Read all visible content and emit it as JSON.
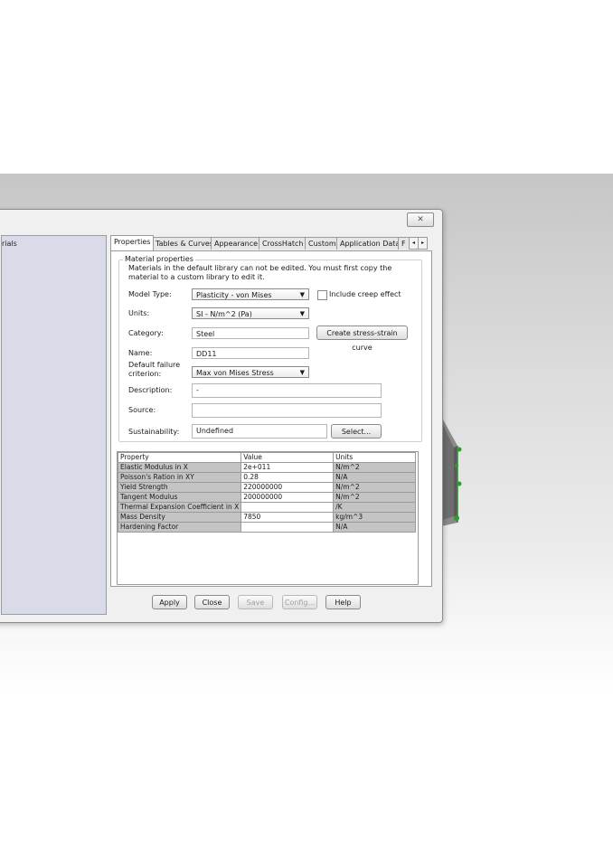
{
  "window": {
    "close_glyph": "✕",
    "tree_item": "rials"
  },
  "tabs": [
    {
      "label": "Properties"
    },
    {
      "label": "Tables & Curves"
    },
    {
      "label": "Appearance"
    },
    {
      "label": "CrossHatch"
    },
    {
      "label": "Custom"
    },
    {
      "label": "Application Data"
    },
    {
      "label": "F"
    }
  ],
  "tab_scroll": {
    "left": "◂",
    "right": "▸"
  },
  "material": {
    "group_title": "Material properties",
    "note": "Materials in the default library can not be edited. You must first copy the material to a custom library to edit it.",
    "model_type_label": "Model Type:",
    "model_type_value": "Plasticity - von Mises",
    "creep_label": "Include creep effect",
    "units_label": "Units:",
    "units_value": "SI - N/m^2 (Pa)",
    "category_label": "Category:",
    "category_value": "Steel",
    "stress_strain_button": "Create stress-strain curve",
    "name_label": "Name:",
    "name_value": "DD11",
    "failure_label": "Default failure criterion:",
    "failure_value": "Max von Mises Stress",
    "description_label": "Description:",
    "description_value": "-",
    "source_label": "Source:",
    "source_value": "",
    "sustainability_label": "Sustainability:",
    "sustainability_value": "Undefined",
    "select_button": "Select...",
    "combo_arrow": "▼"
  },
  "table": {
    "headers": [
      "Property",
      "Value",
      "Units"
    ],
    "rows": [
      {
        "property": "Elastic Modulus in X",
        "value": "2e+011",
        "units": "N/m^2"
      },
      {
        "property": "Poisson's Ration in XY",
        "value": "0.28",
        "units": "N/A"
      },
      {
        "property": "Yield Strength",
        "value": "220000000",
        "units": "N/m^2"
      },
      {
        "property": "Tangent Modulus",
        "value": "200000000",
        "units": "N/m^2"
      },
      {
        "property": "Thermal Expansion Coefficient in X",
        "value": "",
        "units": "/K"
      },
      {
        "property": "Mass Density",
        "value": "7850",
        "units": "kg/m^3"
      },
      {
        "property": "Hardening Factor",
        "value": "",
        "units": "N/A"
      }
    ]
  },
  "buttons": {
    "apply": "Apply",
    "close": "Close",
    "save": "Save",
    "config": "Config...",
    "help": "Help"
  }
}
